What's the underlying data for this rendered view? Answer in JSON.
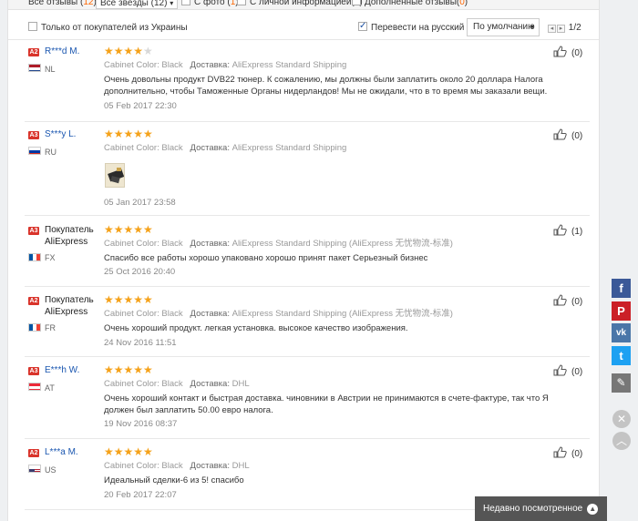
{
  "filters": {
    "all_reviews": {
      "label": "Все отзывы (",
      "count": "12",
      "close": ")"
    },
    "all_stars": "Все звёзды (12)",
    "with_photo": {
      "label": "С фото (",
      "count": "1",
      "close": ")"
    },
    "with_personal": {
      "label": "С личной информацией(",
      "count": "0",
      "close": ")"
    },
    "additional": {
      "label": "Дополненные отзывы(",
      "count": "0",
      "close": ")"
    }
  },
  "options": {
    "ukraine_only": "Только от покупателей из Украины",
    "translate": "Перевести на русский",
    "sort": "По умолчанию",
    "page": "1/2"
  },
  "labels": {
    "color_key": "Cabinet Color:",
    "shipping_key": "Доставка:"
  },
  "reviews": [
    {
      "level": "A2",
      "name": "R***d M.",
      "country": "NL",
      "stars": 4,
      "color": "Black",
      "shipping": "AliExpress Standard Shipping",
      "text": "Очень довольны продукт DVB22 тюнер. К сожалению, мы должны были заплатить около 20 доллара Налога дополнительно, чтобы Таможенные Органы нидерландов! Мы не ожидали, что в то время мы заказали вещи.",
      "date": "05 Feb 2017 22:30",
      "likes": "(0)"
    },
    {
      "level": "A3",
      "name": "S***y L.",
      "country": "RU",
      "stars": 5,
      "color": "Black",
      "shipping": "AliExpress Standard Shipping",
      "text": "",
      "date": "05 Jan 2017 23:58",
      "likes": "(0)"
    },
    {
      "level": "A3",
      "name": "Покупатель AliExpress",
      "country": "FX",
      "stars": 5,
      "color": "Black",
      "shipping": "AliExpress Standard Shipping (AliExpress 无忧物流-标准)",
      "text": "Спасибо все работы хорошо упаковано хорошо принят пакет Серьезный бизнес",
      "date": "25 Oct 2016 20:40",
      "likes": "(1)"
    },
    {
      "level": "A2",
      "name": "Покупатель AliExpress",
      "country": "FR",
      "stars": 5,
      "color": "Black",
      "shipping": "AliExpress Standard Shipping (AliExpress 无忧物流-标准)",
      "text": "Очень хороший продукт. легкая установка. высокое качество изображения.",
      "date": "24 Nov 2016 11:51",
      "likes": "(0)"
    },
    {
      "level": "A3",
      "name": "E***h W.",
      "country": "AT",
      "stars": 5,
      "color": "Black",
      "shipping": "DHL",
      "text": "Очень хороший контакт и быстрая доставка. чиновники в Австрии не принимаются в счете-фактуре, так что Я должен был заплатить 50.00 евро налога.",
      "date": "19 Nov 2016 08:37",
      "likes": "(0)"
    },
    {
      "level": "A2",
      "name": "L***a M.",
      "country": "US",
      "stars": 5,
      "color": "Black",
      "shipping": "DHL",
      "text": "Идеальный сделки-6 из 5! спасибо",
      "date": "20 Feb 2017 22:07",
      "likes": "(0)"
    }
  ],
  "recently_viewed": "Недавно посмотренное",
  "social": {
    "facebook": {
      "glyph": "f",
      "color": "#3b5998"
    },
    "pinterest": {
      "glyph": "P",
      "color": "#cb2027"
    },
    "vk": {
      "glyph": "vk",
      "color": "#4a76a8"
    },
    "twitter": {
      "glyph": "t",
      "color": "#1da1f2"
    },
    "edit": {
      "glyph": "✎",
      "color": "#777777"
    }
  },
  "colors": {
    "accent_orange": "#ff6600",
    "star": "#f5a21a",
    "link_blue": "#1a56b0",
    "level_red": "#d9342b"
  }
}
